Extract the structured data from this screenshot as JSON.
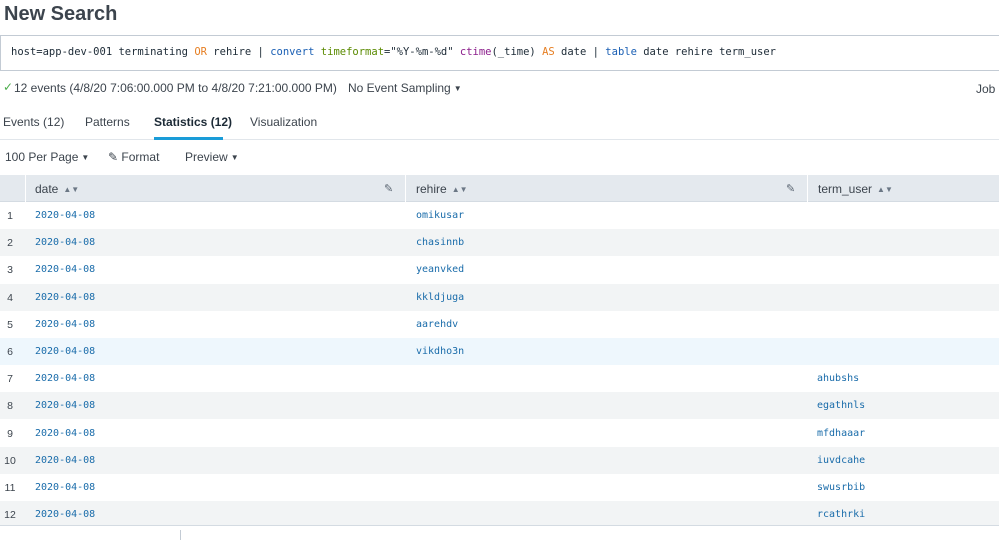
{
  "page": {
    "title": "New Search"
  },
  "search": {
    "tokens": [
      {
        "t": "host=app-dev-001 terminating ",
        "k": "str"
      },
      {
        "t": "OR",
        "k": "op"
      },
      {
        "t": " rehire | ",
        "k": "str"
      },
      {
        "t": "convert",
        "k": "cmd"
      },
      {
        "t": " ",
        "k": "str"
      },
      {
        "t": "timeformat",
        "k": "arg"
      },
      {
        "t": "=\"%Y-%m-%d\" ",
        "k": "str"
      },
      {
        "t": "ctime",
        "k": "fn"
      },
      {
        "t": "(_time) ",
        "k": "str"
      },
      {
        "t": "AS",
        "k": "op"
      },
      {
        "t": " date | ",
        "k": "str"
      },
      {
        "t": "table",
        "k": "cmd"
      },
      {
        "t": " date rehire term_user",
        "k": "str"
      }
    ]
  },
  "status": {
    "check_icon": "✓",
    "summary": "12 events (4/8/20 7:06:00.000 PM to 4/8/20 7:21:00.000 PM)",
    "sampling": "No Event Sampling",
    "job": "Job"
  },
  "tabs": [
    {
      "label": "Events (12)",
      "active": false
    },
    {
      "label": "Patterns",
      "active": false
    },
    {
      "label": "Statistics (12)",
      "active": true
    },
    {
      "label": "Visualization",
      "active": false
    }
  ],
  "toolbar": {
    "per_page": "100 Per Page",
    "format": "Format",
    "preview": "Preview"
  },
  "table": {
    "columns": [
      "date",
      "rehire",
      "term_user"
    ],
    "rows": [
      {
        "n": "1",
        "date": "2020-04-08",
        "rehire": "omikusar",
        "term_user": ""
      },
      {
        "n": "2",
        "date": "2020-04-08",
        "rehire": "chasinnb",
        "term_user": ""
      },
      {
        "n": "3",
        "date": "2020-04-08",
        "rehire": "yeanvked",
        "term_user": ""
      },
      {
        "n": "4",
        "date": "2020-04-08",
        "rehire": "kkldjuga",
        "term_user": ""
      },
      {
        "n": "5",
        "date": "2020-04-08",
        "rehire": "aarehdv",
        "term_user": ""
      },
      {
        "n": "6",
        "date": "2020-04-08",
        "rehire": "vikdho3n",
        "term_user": ""
      },
      {
        "n": "7",
        "date": "2020-04-08",
        "rehire": "",
        "term_user": "ahubshs"
      },
      {
        "n": "8",
        "date": "2020-04-08",
        "rehire": "",
        "term_user": "egathnls"
      },
      {
        "n": "9",
        "date": "2020-04-08",
        "rehire": "",
        "term_user": "mfdhaaar"
      },
      {
        "n": "10",
        "date": "2020-04-08",
        "rehire": "",
        "term_user": "iuvdcahe"
      },
      {
        "n": "11",
        "date": "2020-04-08",
        "rehire": "",
        "term_user": "swusrbib"
      },
      {
        "n": "12",
        "date": "2020-04-08",
        "rehire": "",
        "term_user": "rcathrki"
      }
    ]
  }
}
